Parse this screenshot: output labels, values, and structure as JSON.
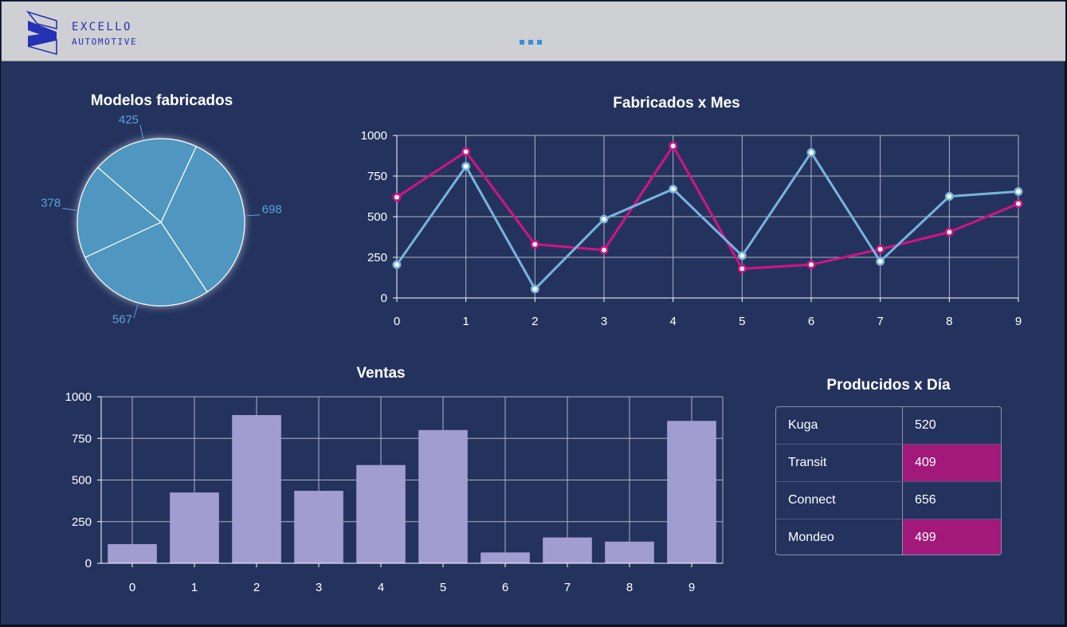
{
  "app": {
    "brand_name": "EXCELLO",
    "brand_sub": "AUTOMOTIVE",
    "menu_icon": "more-dots-icon"
  },
  "colors": {
    "background": "#24335e",
    "header": "#cfd0d3",
    "pie_fill": "#4f97c0",
    "line_series_1": "#d31385",
    "line_series_2": "#78b4dc",
    "bar_fill": "#a29dd0",
    "table_highlight": "#a3197a",
    "brand": "#2632b4"
  },
  "panels": {
    "pie_title": "Modelos fabricados",
    "line_title": "Fabricados x Mes",
    "bar_title": "Ventas",
    "table_title": "Producidos x Día"
  },
  "chart_data": [
    {
      "type": "pie",
      "title": "Modelos fabricados",
      "values": [
        698,
        567,
        378,
        425
      ],
      "labels": [
        "698",
        "567",
        "378",
        "425"
      ]
    },
    {
      "type": "line",
      "title": "Fabricados x Mes",
      "x": [
        0,
        1,
        2,
        3,
        4,
        5,
        6,
        7,
        8,
        9
      ],
      "ylim": [
        0,
        1000
      ],
      "yticks": [
        0,
        250,
        500,
        750,
        1000
      ],
      "grid": true,
      "series": [
        {
          "values": [
            620,
            900,
            330,
            295,
            935,
            180,
            205,
            300,
            405,
            580
          ]
        },
        {
          "values": [
            205,
            810,
            55,
            485,
            670,
            260,
            895,
            225,
            625,
            655
          ]
        }
      ]
    },
    {
      "type": "bar",
      "title": "Ventas",
      "categories": [
        "0",
        "1",
        "2",
        "3",
        "4",
        "5",
        "6",
        "7",
        "8",
        "9"
      ],
      "values": [
        115,
        425,
        890,
        435,
        590,
        800,
        65,
        155,
        130,
        855
      ],
      "ylim": [
        0,
        1000
      ],
      "yticks": [
        0,
        250,
        500,
        750,
        1000
      ],
      "grid": true
    },
    {
      "type": "table",
      "title": "Producidos x Día",
      "rows": [
        {
          "name": "Kuga",
          "value": "520",
          "highlight": false
        },
        {
          "name": "Transit",
          "value": "409",
          "highlight": true
        },
        {
          "name": "Connect",
          "value": "656",
          "highlight": false
        },
        {
          "name": "Mondeo",
          "value": "499",
          "highlight": true
        }
      ]
    }
  ],
  "table": {
    "rows": [
      {
        "name": "Kuga",
        "value": "520"
      },
      {
        "name": "Transit",
        "value": "409"
      },
      {
        "name": "Connect",
        "value": "656"
      },
      {
        "name": "Mondeo",
        "value": "499"
      }
    ]
  }
}
